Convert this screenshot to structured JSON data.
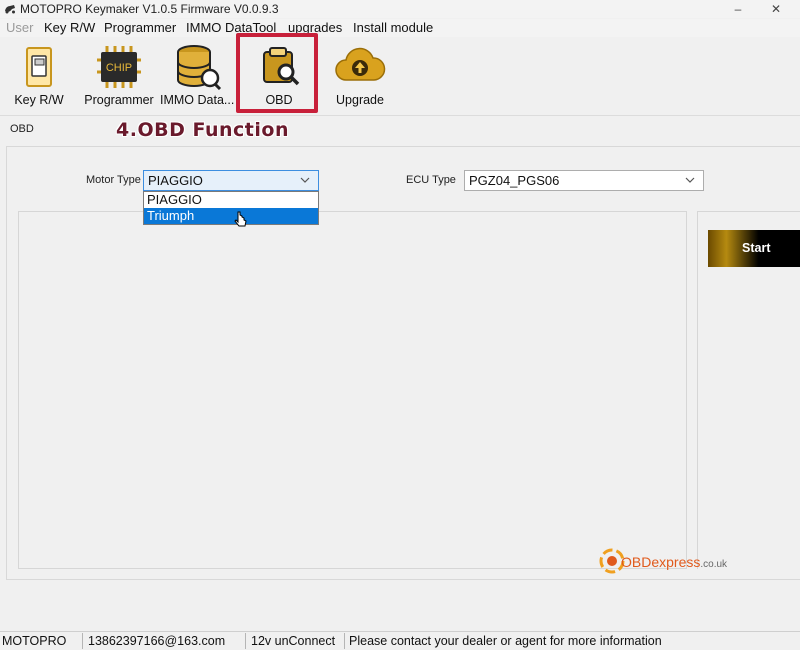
{
  "window": {
    "title": "MOTOPRO Keymaker V1.0.5 Firmware V0.0.9.3",
    "minimize": "–",
    "close": "✕"
  },
  "menu": [
    "User",
    "Key R/W",
    "Programmer",
    "IMMO DataTool",
    "upgrades",
    "Install module"
  ],
  "toolbar": {
    "items": [
      {
        "label": "Key R/W",
        "icon": "key-card-icon"
      },
      {
        "label": "Programmer",
        "icon": "chip-icon"
      },
      {
        "label": "IMMO Data...",
        "icon": "database-tool-icon"
      },
      {
        "label": "OBD",
        "icon": "obd-folder-search-icon",
        "active": true
      },
      {
        "label": "Upgrade",
        "icon": "cloud-upload-icon"
      }
    ],
    "chip_text": "CHIP"
  },
  "section": {
    "label": "OBD"
  },
  "annotation": "4.OBD Function",
  "form": {
    "motor_type_label": "Motor Type",
    "motor_type_value": "PIAGGIO",
    "ecu_type_label": "ECU Type",
    "ecu_type_value": "PGZ04_PGS06"
  },
  "dropdown": {
    "options": [
      "PIAGGIO",
      "Triumph"
    ],
    "highlighted": "Triumph"
  },
  "start_button": "Start",
  "watermark": {
    "brand": "OBDexpress",
    "domain": ".co.uk"
  },
  "status": {
    "brand": "MOTOPRO",
    "email": "13862397166@163.com",
    "connection": "12v unConnect",
    "message": "Please contact your dealer or agent for more information"
  },
  "colors": {
    "highlight_border": "#c8203a",
    "selected_option": "#0a78d7",
    "annotation_text": "#6a1a2c",
    "icon_gold": "#c8961e"
  }
}
